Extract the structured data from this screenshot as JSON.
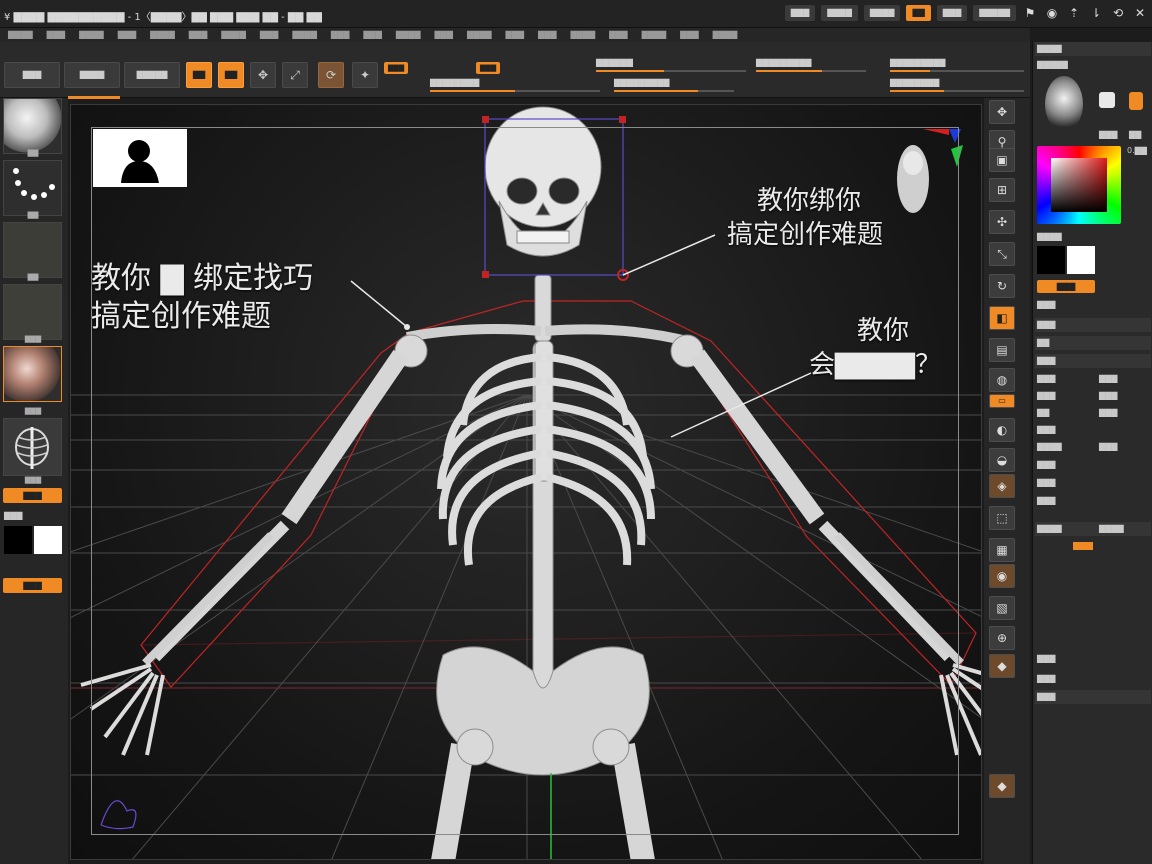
{
  "titlebar": {
    "title": "¥ ▇▇▇▇ ▇▇▇▇▇▇▇▇▇▇ - 1〈▇▇▇▇〉▇▇ ▇▇▇ ▇▇▇ ▇▇ - ▇▇ ▇▇",
    "chips": [
      "▇▇▇",
      "▇▇▇▇",
      "▇▇▇▇",
      "▇▇",
      "▇▇▇",
      "▇▇▇▇▇"
    ],
    "icons": [
      "⚑",
      "◉",
      "⇡",
      "⇂",
      "⟲",
      "✕"
    ]
  },
  "menu": [
    "▇▇▇▇",
    "▇▇▇",
    "▇▇▇▇",
    "▇▇▇",
    "▇▇▇▇",
    "▇▇▇",
    "▇▇▇▇",
    "▇▇▇",
    "▇▇▇▇",
    "▇▇▇",
    "▇▇▇",
    "▇▇▇▇",
    "▇▇▇",
    "▇▇▇▇",
    "▇▇▇",
    "▇▇▇",
    "▇▇▇▇",
    "▇▇▇",
    "▇▇▇▇",
    "▇▇▇",
    "▇▇▇▇"
  ],
  "toolbar": {
    "buttons": [
      "▇▇▇",
      "▇▇▇▇",
      "▇▇▇▇▇",
      "▇▇",
      "▇▇"
    ],
    "orange_tags": [
      "▇▇▇",
      "▇▇▇"
    ],
    "sliders": [
      {
        "label": "▇▇▇▇▇▇",
        "value": 0.45
      },
      {
        "label": "▇▇▇▇▇▇▇▇▇",
        "value": 0.6
      },
      {
        "label": "▇▇▇▇▇▇▇▇▇",
        "value": 0.3
      },
      {
        "label": "▇▇▇▇▇▇▇▇",
        "value": 0.5
      },
      {
        "label": "▇▇▇▇▇▇▇▇▇",
        "value": 0.7
      },
      {
        "label": "▇▇▇▇▇▇▇▇",
        "value": 0.4
      }
    ]
  },
  "left": {
    "labels": [
      "▇▇",
      "▇▇",
      "▇▇",
      "▇▇▇",
      "▇▇▇",
      "▇▇▇"
    ],
    "pills": [
      "▇▇▇",
      "▇▇▇"
    ],
    "section": "▇▇▇"
  },
  "viewport": {
    "annotations": [
      {
        "line1": "教你 ▇ 绑定找巧",
        "line2": "搞定创作难题"
      },
      {
        "line1": "教你绑你",
        "line2": "搞定创作难题"
      },
      {
        "line1": "教你",
        "line2": "会▇▇▇▇？"
      }
    ]
  },
  "right_panel": {
    "rows": [
      "▇▇▇▇",
      "▇▇▇▇▇",
      "▇▇▇",
      "▇▇",
      "▇▇▇▇",
      "▇▇▇",
      "▇▇▇",
      "▇▇",
      "▇▇▇",
      "▇▇▇",
      "▇▇▇",
      "▇▇",
      "▇▇▇",
      "▇▇▇▇",
      "▇▇▇",
      "▇▇▇",
      "▇▇▇",
      "▇▇▇▇",
      "▇▇▇",
      "▇▇▇",
      "▇▇▇"
    ],
    "orange": "▇▇▇",
    "value_labels": [
      "0.▇▇",
      "▇▇▇",
      "▇▇▇",
      "▇▇▇",
      "▇▇▇",
      "▇▇▇▇"
    ]
  },
  "colors": {
    "accent": "#f08a24",
    "bg": "#1c1c1c",
    "grid": "#555555",
    "outline": "#c22424"
  }
}
